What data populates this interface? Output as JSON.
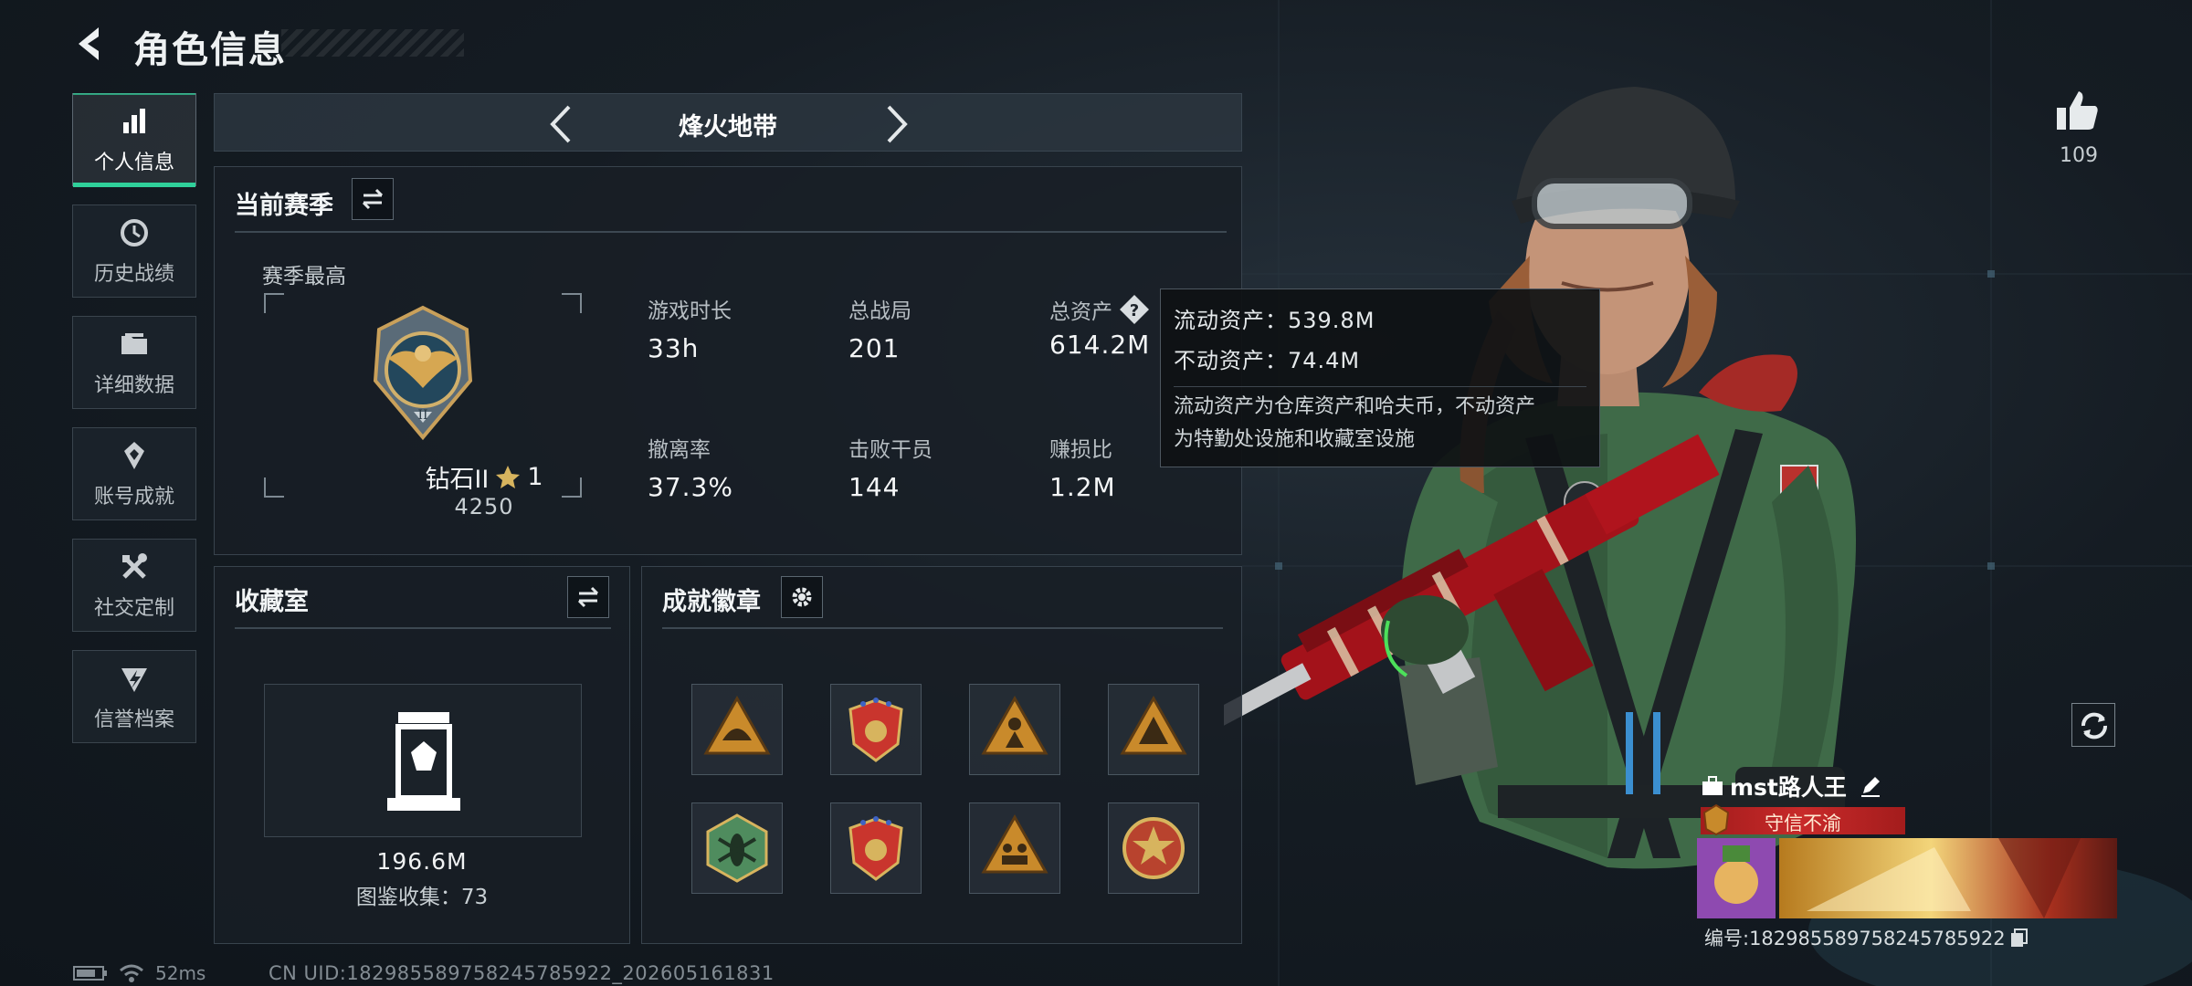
{
  "header": {
    "title": "角色信息"
  },
  "nav": {
    "items": [
      {
        "label": "个人信息",
        "icon": "bar-chart-icon",
        "active": true
      },
      {
        "label": "历史战绩",
        "icon": "clock-icon",
        "active": false
      },
      {
        "label": "详细数据",
        "icon": "folder-icon",
        "active": false
      },
      {
        "label": "账号成就",
        "icon": "achievement-icon",
        "active": false
      },
      {
        "label": "社交定制",
        "icon": "tools-icon",
        "active": false
      },
      {
        "label": "信誉档案",
        "icon": "credit-icon",
        "active": false
      }
    ]
  },
  "mode": {
    "title": "烽火地带"
  },
  "season": {
    "title": "当前赛季",
    "best_label": "赛季最高",
    "rank_name": "钻石II",
    "rank_stars": "1",
    "rank_score": "4250",
    "stats": [
      {
        "label": "游戏时长",
        "value": "33h"
      },
      {
        "label": "总战局",
        "value": "201"
      },
      {
        "label": "总资产",
        "value": "614.2M"
      },
      {
        "label": "撤离率",
        "value": "37.3%"
      },
      {
        "label": "击败干员",
        "value": "144"
      },
      {
        "label": "赚损比",
        "value": "1.2M"
      }
    ]
  },
  "tooltip": {
    "liquid": "流动资产：539.8M",
    "fixed": "不动资产：74.4M",
    "desc_line1": "流动资产为仓库资产和哈夫币，不动资产",
    "desc_line2": "为特勤处设施和收藏室设施"
  },
  "collection": {
    "title": "收藏室",
    "value": "196.6M",
    "count_label": "图鉴收集：73"
  },
  "achievements": {
    "title": "成就徽章",
    "badges": [
      {
        "icon": "hard-hat-badge-icon",
        "color": "#c98a2b"
      },
      {
        "icon": "shield-starred-badge-icon",
        "color": "#c9352d"
      },
      {
        "icon": "soldier-badge-icon",
        "color": "#c98a2b"
      },
      {
        "icon": "triangle-badge-icon",
        "color": "#c98a2b"
      },
      {
        "icon": "insect-badge-icon",
        "color": "#4f8c5e"
      },
      {
        "icon": "shield-starred-badge-icon",
        "color": "#c9352d"
      },
      {
        "icon": "squad-badge-icon",
        "color": "#c98a2b"
      },
      {
        "icon": "star-medal-badge-icon",
        "color": "#b8432e"
      }
    ]
  },
  "social": {
    "likes": "109"
  },
  "player": {
    "name": "mst路人王",
    "title": "守信不渝",
    "id_label": "编号:1829855897582457859​22"
  },
  "footer": {
    "ping": "52ms",
    "uid": "CN UID:1829855897582457859​22_202605161831"
  },
  "colors": {
    "accent": "#2fd09a",
    "title_banner": "#c82a2a",
    "tooltip_bg": "#0e1114"
  }
}
